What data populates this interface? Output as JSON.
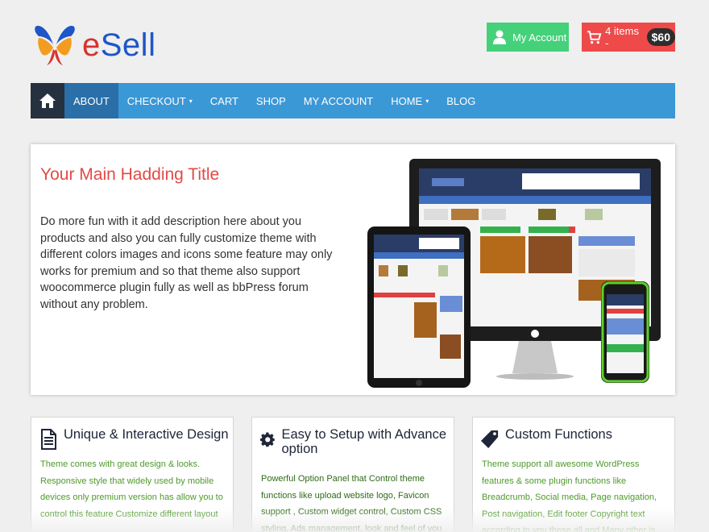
{
  "header": {
    "logo_text_e": "e",
    "logo_text_rest": "Sell",
    "account_label": "My Account",
    "cart_label": "4 items -",
    "cart_total": "$60"
  },
  "nav": {
    "items": [
      {
        "label": "ABOUT",
        "active": true
      },
      {
        "label": "CHECKOUT",
        "dropdown": true
      },
      {
        "label": "CART"
      },
      {
        "label": "SHOP"
      },
      {
        "label": "MY ACCOUNT"
      },
      {
        "label": "HOME",
        "dropdown": true
      },
      {
        "label": "BLOG"
      }
    ],
    "caret": "▾"
  },
  "hero": {
    "title": "Your Main Hadding Title",
    "description": "Do more fun with it add description here about you products and also you can fully customize theme with different colors images and icons some feature may only works for premium and so that theme also support woocommerce plugin fully as well as bbPress forum without any problem."
  },
  "features": [
    {
      "title": "Unique & Interactive Design",
      "icon": "document-icon",
      "text": "Theme comes with great design & looks. Responsive style that widely used by mobile devices only premium version has allow you to control this feature Customize different layout"
    },
    {
      "title": "Easy to Setup with Advance option",
      "icon": "gear-icon",
      "text": "Powerful Option Panel that Control theme functions like upload website logo, Favicon support , Custom widget control, Custom CSS styling, Ads management, look and feel of you"
    },
    {
      "title": "Custom Functions",
      "icon": "tag-icon",
      "text": "Theme support all awesome WordPress features & some plugin functions like Breadcrumb, Social media, Page navigation, Post navigation, Edit footer Copyright text according to you these all and Many other is Theme Option Panel"
    }
  ],
  "colors": {
    "nav_bg": "#3b98d6",
    "nav_active": "#2a6fa8",
    "account_btn": "#44d17a",
    "cart_btn": "#ee4a4a",
    "hero_title": "#e24a45",
    "feature_text": "#4e9a2a"
  }
}
